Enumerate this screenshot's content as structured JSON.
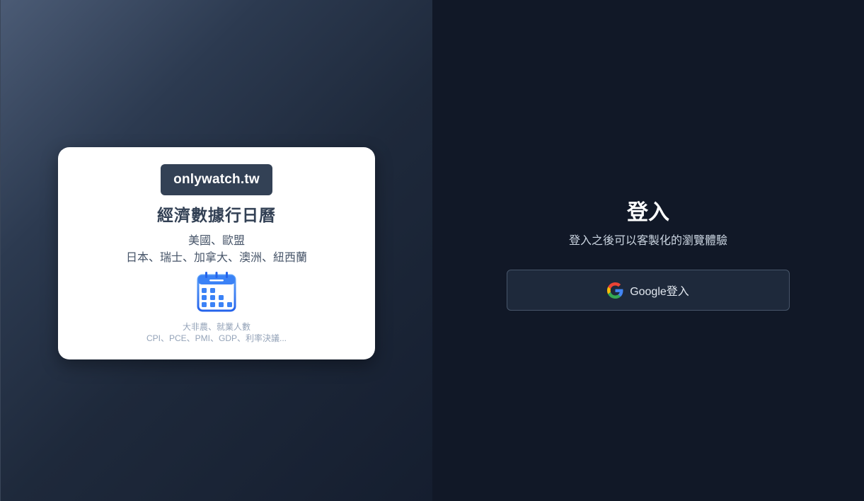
{
  "promo": {
    "brand": "onlywatch.tw",
    "title": "經濟數據行日曆",
    "regions_line1": "美國、歐盟",
    "regions_line2": "日本、瑞士、加拿大、澳洲、紐西蘭",
    "icon": "calendar-icon",
    "indicators_line1": "大非農、就業人數",
    "indicators_line2": "CPI、PCE、PMI、GDP、利率決議..."
  },
  "login": {
    "title": "登入",
    "subtitle": "登入之後可以客製化的瀏覽體驗",
    "google_button_label": "Google登入",
    "google_icon": "google-icon"
  },
  "colors": {
    "card_bg": "#ffffff",
    "brand_bg": "#334155",
    "page_bg": "#111827",
    "button_bg": "#1e293b",
    "calendar_blue": "#3b82f6"
  }
}
